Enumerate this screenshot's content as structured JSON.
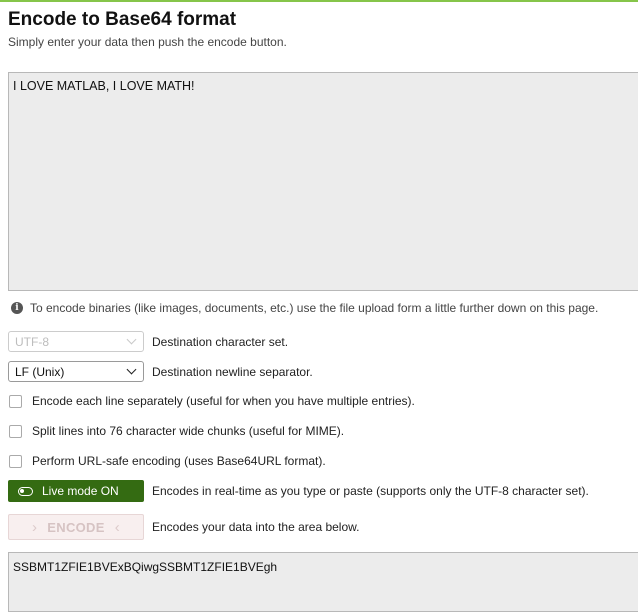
{
  "header": {
    "title": "Encode to Base64 format",
    "subtitle": "Simply enter your data then push the encode button."
  },
  "input": {
    "value": "I LOVE MATLAB, I LOVE MATH!"
  },
  "info": {
    "icon": "info-icon",
    "text": "To encode binaries (like images, documents, etc.) use the file upload form a little further down on this page."
  },
  "options": {
    "charset": {
      "value": "UTF-8",
      "label": "Destination character set.",
      "disabled": true
    },
    "newline": {
      "value": "LF (Unix)",
      "label": "Destination newline separator."
    },
    "each_line": {
      "label": "Encode each line separately (useful for when you have multiple entries).",
      "checked": false
    },
    "split_lines": {
      "label": "Split lines into 76 character wide chunks (useful for MIME).",
      "checked": false
    },
    "url_safe": {
      "label": "Perform URL-safe encoding (uses Base64URL format).",
      "checked": false
    },
    "live_mode": {
      "button_label": "Live mode ON",
      "label": "Encodes in real-time as you type or paste (supports only the UTF-8 character set).",
      "on": true,
      "color": "#346b12"
    },
    "encode": {
      "button_label": "ENCODE",
      "label": "Encodes your data into the area below.",
      "disabled": true
    }
  },
  "output": {
    "value": "SSBMT1ZFIE1BVExBQiwgSSBMT1ZFIE1BVEgh"
  },
  "colors": {
    "accent_line": "#86c54a",
    "live_mode_bg": "#346b12",
    "textarea_bg": "#ececec"
  }
}
